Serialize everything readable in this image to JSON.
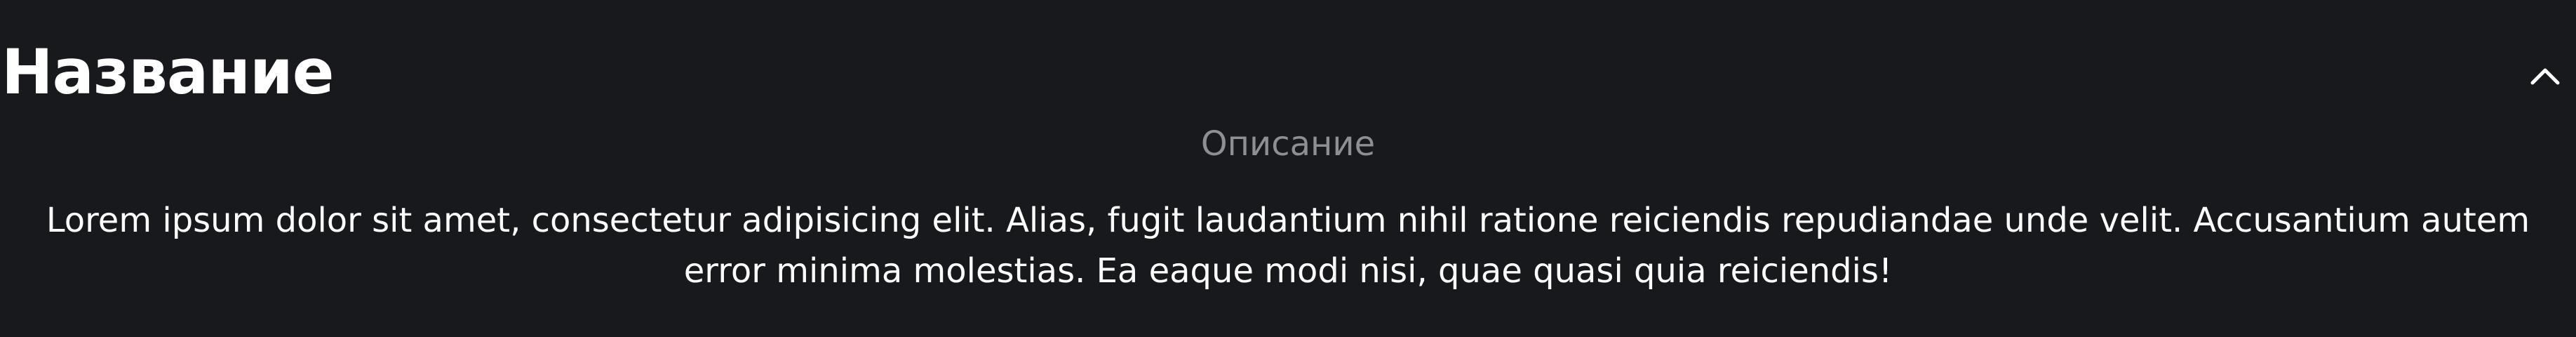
{
  "section": {
    "title": "Название",
    "toggle_icon": "chevron-up-icon",
    "subtitle": "Описание",
    "body": "Lorem ipsum dolor sit amet, consectetur adipisicing elit. Alias, fugit laudantium nihil ratione reiciendis repudiandae unde velit. Accusantium autem error minima molestias. Ea eaque modi nisi, quae quasi quia reiciendis!"
  },
  "colors": {
    "background": "#17191d",
    "title": "#ffffff",
    "subtitle": "#8c8f94",
    "body": "#ffffff"
  }
}
